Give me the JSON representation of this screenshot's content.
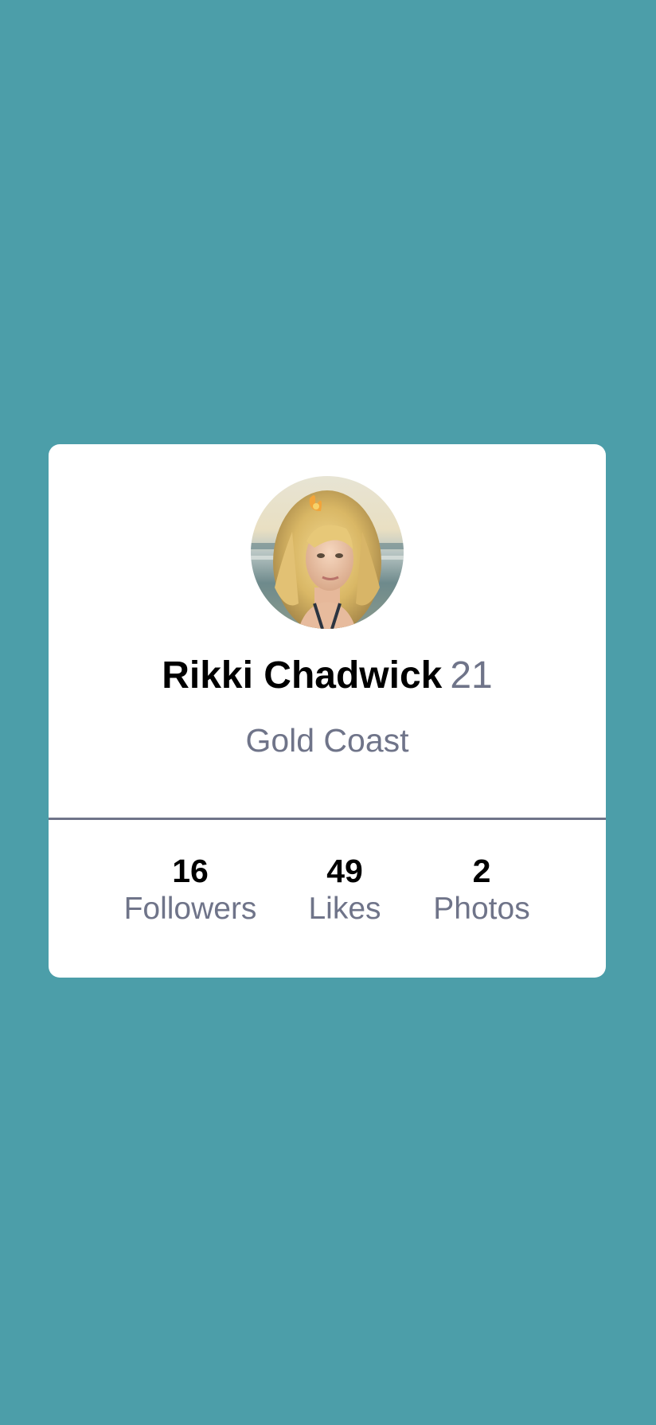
{
  "colors": {
    "background": "#4c9ea9",
    "card": "#ffffff",
    "muted_text": "#6f7489",
    "primary_text": "#000000"
  },
  "profile": {
    "avatar_icon": "profile-photo",
    "name": "Rikki Chadwick",
    "age": "21",
    "location": "Gold Coast"
  },
  "stats": [
    {
      "value": "16",
      "label": "Followers"
    },
    {
      "value": "49",
      "label": "Likes"
    },
    {
      "value": "2",
      "label": "Photos"
    }
  ]
}
